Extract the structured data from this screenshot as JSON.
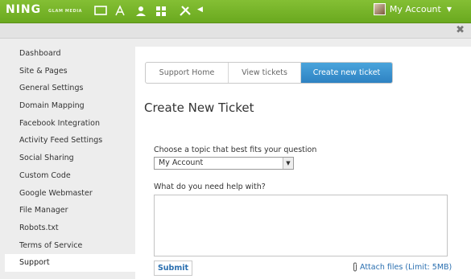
{
  "brand": {
    "name": "NING",
    "sub": "GLAM MEDIA"
  },
  "toolbar_icons": [
    "monitor-icon",
    "palette-icon",
    "person-icon",
    "grid-icon",
    "tools-icon",
    "collapse-arrow-icon"
  ],
  "account": {
    "label": "My Account"
  },
  "sidebar": {
    "items": [
      {
        "label": "Dashboard"
      },
      {
        "label": "Site & Pages"
      },
      {
        "label": "General Settings"
      },
      {
        "label": "Domain Mapping"
      },
      {
        "label": "Facebook Integration"
      },
      {
        "label": "Activity Feed Settings"
      },
      {
        "label": "Social Sharing"
      },
      {
        "label": "Custom Code"
      },
      {
        "label": "Google Webmaster"
      },
      {
        "label": "File Manager"
      },
      {
        "label": "Robots.txt"
      },
      {
        "label": "Terms of Service"
      },
      {
        "label": "Support"
      }
    ],
    "active": "Support"
  },
  "tabs": [
    {
      "label": "Support Home"
    },
    {
      "label": "View tickets"
    },
    {
      "label": "Create new ticket"
    }
  ],
  "form": {
    "title": "Create New Ticket",
    "topic_label": "Choose a topic that best fits your question",
    "topic_value": "My Account",
    "help_label": "What do you need help with?",
    "help_value": "",
    "submit_label": "Submit",
    "attach_label": "Attach files (Limit: 5MB)"
  },
  "colors": {
    "topbar": "#7ab52a",
    "active_tab": "#3a94d2",
    "link": "#2a6fb0"
  }
}
